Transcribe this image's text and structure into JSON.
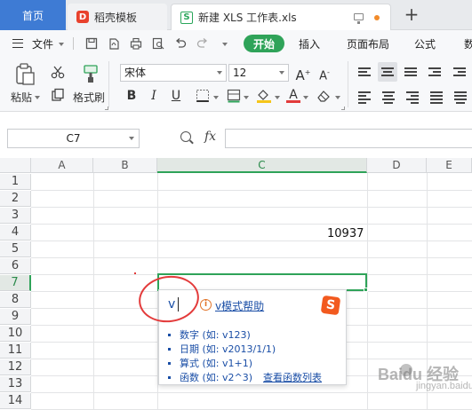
{
  "tabs": {
    "home": "首页",
    "template": "稻壳模板",
    "template_icon_char": "D",
    "file": "新建 XLS 工作表.xls",
    "file_icon_char": "S"
  },
  "menu": {
    "file": "文件",
    "start": "开始",
    "insert": "插入",
    "page_layout": "页面布局",
    "formula": "公式",
    "data_partial": "数"
  },
  "ribbon": {
    "paste": "粘贴",
    "format_painter": "格式刷",
    "font_name": "宋体",
    "font_size": "12"
  },
  "formula_bar": {
    "name_box": "C7",
    "fx": "fx",
    "formula_value": ""
  },
  "sheet": {
    "columns": [
      "A",
      "B",
      "C",
      "D",
      "E"
    ],
    "active_column": "C",
    "rows": [
      "1",
      "2",
      "3",
      "4",
      "5",
      "6",
      "7",
      "8",
      "9",
      "10",
      "11",
      "12",
      "13",
      "14"
    ],
    "active_row": "7",
    "cells": {
      "C4": "10937"
    }
  },
  "popup": {
    "typed": "v",
    "help_link": "v模式帮助",
    "items": [
      "数字 (如: v123)",
      "日期 (如: v2013/1/1)",
      "算式 (如: v1+1)",
      "函数 (如: v2^3)"
    ],
    "function_list_link": "查看函数列表",
    "ime_logo_char": "S"
  },
  "watermark": {
    "main": "Baidu 经验",
    "sub": "jingyan.baidu.com"
  },
  "colors": {
    "accent_green": "#2fa359",
    "home_tab_blue": "#3e7bd4",
    "link_blue": "#1a4ea6",
    "annotation_red": "#e33b3b"
  }
}
